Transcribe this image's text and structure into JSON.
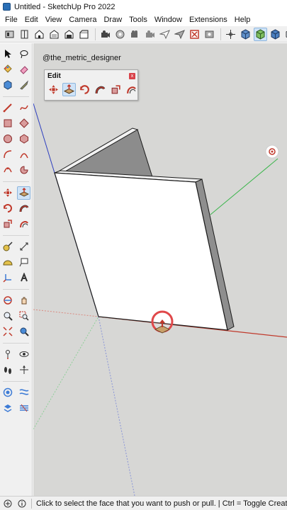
{
  "window": {
    "title": "Untitled - SketchUp Pro 2022"
  },
  "menu": {
    "items": [
      "File",
      "Edit",
      "View",
      "Camera",
      "Draw",
      "Tools",
      "Window",
      "Extensions",
      "Help"
    ]
  },
  "watermark": "@the_metric_designer",
  "edit_toolbar": {
    "title": "Edit",
    "close_glyph": "x"
  },
  "statusbar": {
    "hint": "Click to select the face that you want to push or pull.  |  Ctrl = Toggle Create New Starting Face."
  },
  "colors": {
    "viewport_bg": "#d7d7d5",
    "face": "#ffffff",
    "edge_shadow": "#8c8c8c",
    "axis_red": "#c0392b",
    "axis_green": "#39b54a",
    "axis_blue": "#2e3fbf",
    "active_tool": "#cfe3f7"
  }
}
